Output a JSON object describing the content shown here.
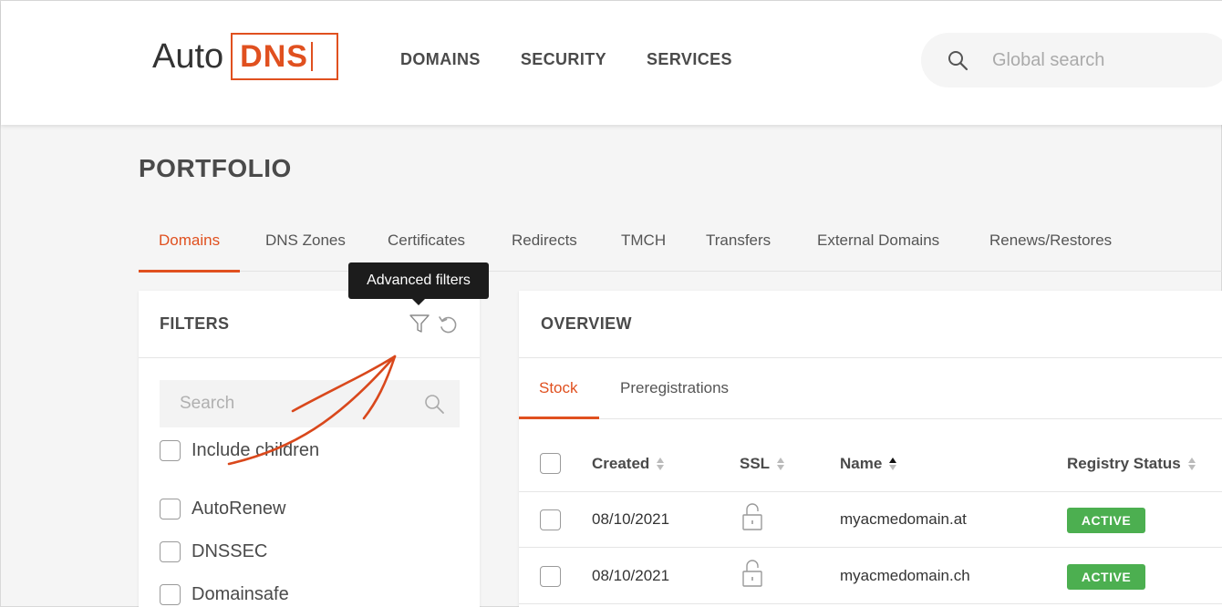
{
  "header": {
    "logo_text_1": "Auto",
    "logo_text_2": "DNS",
    "nav": [
      "DOMAINS",
      "SECURITY",
      "SERVICES"
    ],
    "search_placeholder": "Global search"
  },
  "page_title": "PORTFOLIO",
  "tabs": [
    "Domains",
    "DNS Zones",
    "Certificates",
    "Redirects",
    "TMCH",
    "Transfers",
    "External Domains",
    "Renews/Restores"
  ],
  "tooltip": "Advanced filters",
  "filters": {
    "title": "FILTERS",
    "search_placeholder": "Search",
    "include_children": "Include children",
    "options": [
      "AutoRenew",
      "DNSSEC",
      "Domainsafe"
    ]
  },
  "overview": {
    "title": "OVERVIEW",
    "subtabs": [
      "Stock",
      "Preregistrations"
    ],
    "columns": [
      "Created",
      "SSL",
      "Name",
      "Registry Status"
    ],
    "rows": [
      {
        "created": "08/10/2021",
        "name": "myacmedomain.at",
        "status": "ACTIVE"
      },
      {
        "created": "08/10/2021",
        "name": "myacmedomain.ch",
        "status": "ACTIVE"
      }
    ]
  },
  "colors": {
    "accent": "#e0501f",
    "active_badge": "#4caf50"
  }
}
